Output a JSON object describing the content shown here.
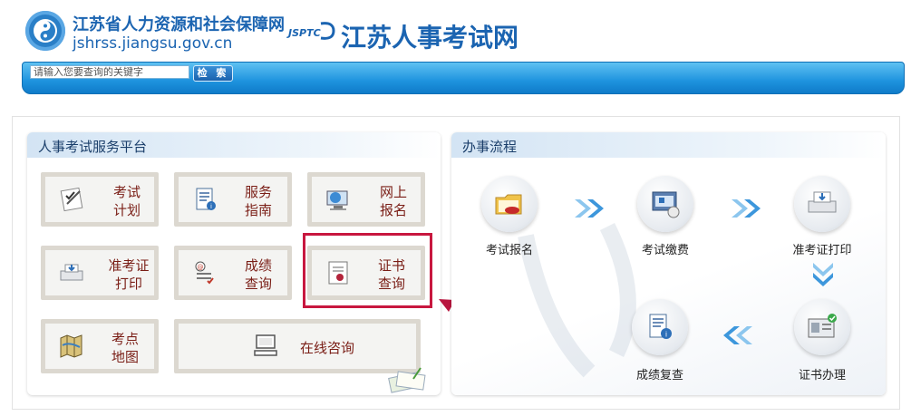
{
  "header": {
    "org_name": "江苏省人力资源和社会保障网",
    "org_url": "jshrss.jiangsu.gov.cn",
    "brand_mark": "JSPTC",
    "site_name": "江苏人事考试网"
  },
  "search": {
    "placeholder": "请输入您要查询的关键字",
    "button_label": "检 索"
  },
  "services": {
    "title": "人事考试服务平台",
    "items": [
      {
        "label": "考试\n计划",
        "icon": "exam-plan-icon"
      },
      {
        "label": "服务\n指南",
        "icon": "service-guide-icon"
      },
      {
        "label": "网上\n报名",
        "icon": "online-registration-icon"
      },
      {
        "label": "准考证\n打印",
        "icon": "admission-print-icon"
      },
      {
        "label": "成绩\n查询",
        "icon": "score-query-icon"
      },
      {
        "label": "证书\n查询",
        "icon": "certificate-query-icon"
      },
      {
        "label": "考点\n地图",
        "icon": "exam-map-icon"
      },
      {
        "label": "在线咨询",
        "icon": "online-consult-icon"
      }
    ]
  },
  "process": {
    "title": "办事流程",
    "steps": [
      {
        "label": "考试报名",
        "icon": "folder-icon"
      },
      {
        "label": "考试缴费",
        "icon": "payment-icon"
      },
      {
        "label": "准考证打印",
        "icon": "printer-icon"
      },
      {
        "label": "证书办理",
        "icon": "id-card-icon"
      },
      {
        "label": "成绩复查",
        "icon": "report-icon"
      }
    ]
  },
  "colors": {
    "brand_blue": "#1b64b1",
    "service_text": "#7a1e16",
    "highlight": "#c8173f",
    "chevron": "#4aa3e0"
  }
}
